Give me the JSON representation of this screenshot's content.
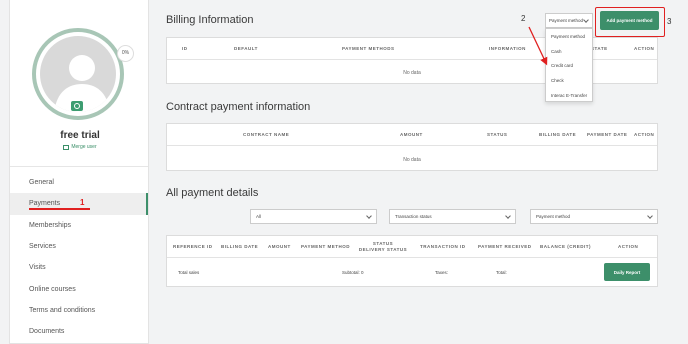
{
  "profile": {
    "name": "free trial",
    "completion": "0%",
    "merge_label": "Merge user"
  },
  "sidebar": {
    "items": [
      {
        "label": "General"
      },
      {
        "label": "Payments"
      },
      {
        "label": "Memberships"
      },
      {
        "label": "Services"
      },
      {
        "label": "Visits"
      },
      {
        "label": "Online courses"
      },
      {
        "label": "Terms and conditions"
      },
      {
        "label": "Documents"
      }
    ],
    "active_index": 1
  },
  "annotations": {
    "step1": "1",
    "step2": "2",
    "step3": "3",
    "color": "#e02020"
  },
  "billing": {
    "title": "Billing Information",
    "columns": [
      "ID",
      "DEFAULT",
      "PAYMENT METHODS",
      "INFORMATION",
      "STATE",
      "ACTION"
    ],
    "empty_text": "No data",
    "payment_method_select": "Payment method",
    "dropdown_options": [
      "Payment method",
      "Cash",
      "Credit card",
      "Check",
      "Interac E-Transfer"
    ],
    "add_button": "Add payment method"
  },
  "contract": {
    "title": "Contract payment information",
    "columns": [
      "CONTRACT NAME",
      "AMOUNT",
      "STATUS",
      "BILLING DATE",
      "PAYMENT DATE",
      "ACTION"
    ],
    "empty_text": "No data"
  },
  "all_payments": {
    "title": "All payment details",
    "filters": [
      "All",
      "Transaction status",
      "Payment method"
    ],
    "columns": [
      "REFERENCE ID",
      "BILLING DATE",
      "AMOUNT",
      "PAYMENT METHOD",
      "STATUS",
      "DELIVERY STATUS",
      "TRANSACTION ID",
      "PAYMENT RECEIVED",
      "BALANCE (CREDIT)",
      "ACTION"
    ],
    "totals_row": {
      "label": "Total sales",
      "subtotal": "Subtotal: 0",
      "taxes": "Taxes:",
      "total": "Total:"
    },
    "daily_report_button": "Daily Report"
  },
  "colors": {
    "accent": "#3d8f6a",
    "highlight": "#e02020"
  }
}
